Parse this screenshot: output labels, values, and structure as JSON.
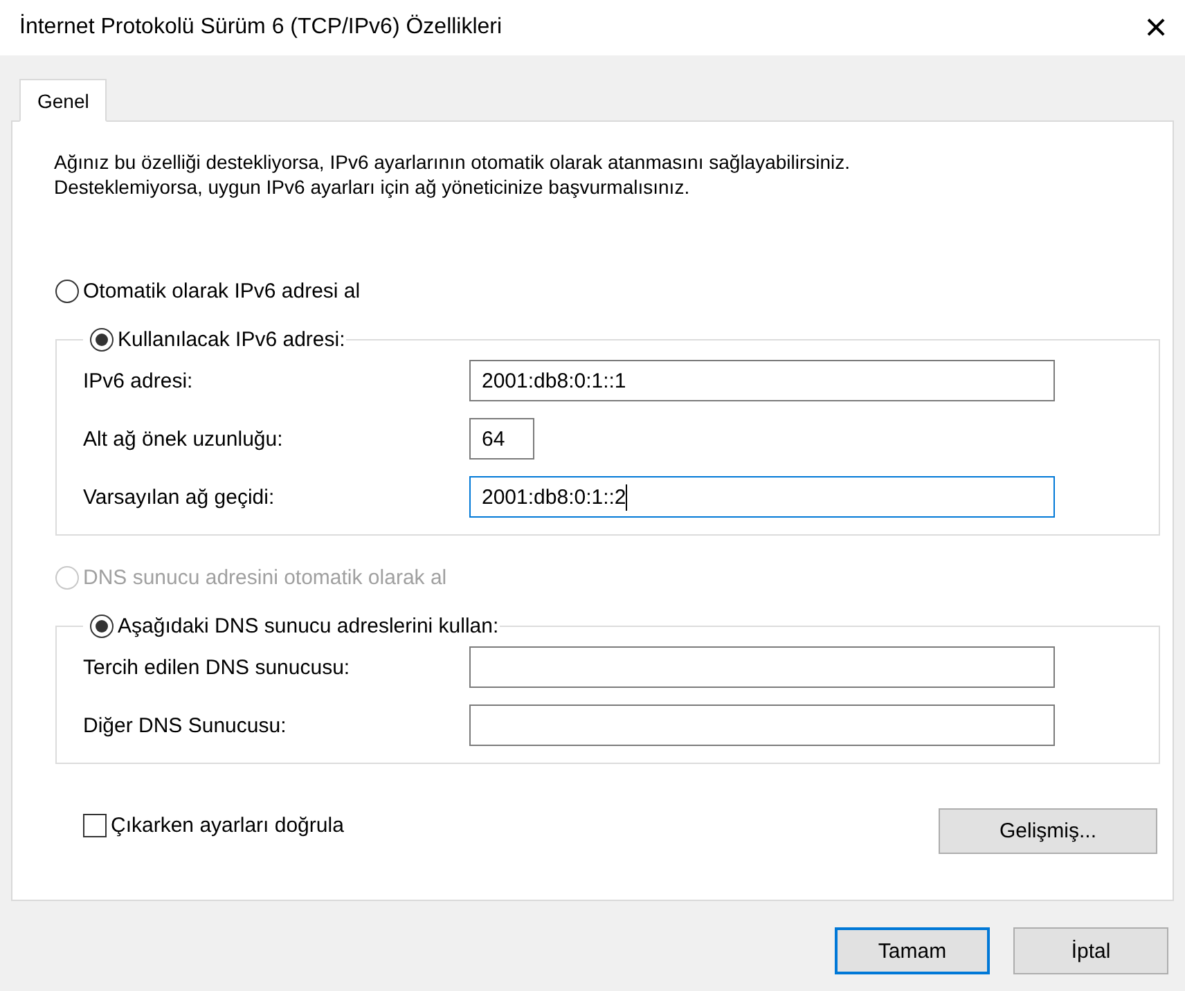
{
  "window": {
    "title": "İnternet Protokolü Sürüm 6 (TCP/IPv6) Özellikleri",
    "close": "×"
  },
  "tabs": [
    {
      "label": "Genel",
      "selected": true
    }
  ],
  "description": [
    "Ağınız bu özelliği destekliyorsa, IPv6 ayarlarının otomatik olarak atanmasını sağlayabilirsiniz.",
    "Desteklemiyorsa, uygun IPv6 ayarları için ağ yöneticinize başvurmalısınız."
  ],
  "address_section": {
    "auto_option": {
      "label": "Otomatik olarak IPv6 adresi al",
      "selected": false,
      "disabled": false
    },
    "manual_option": {
      "label": "Kullanılacak IPv6 adresi:",
      "selected": true,
      "disabled": false
    },
    "fields": [
      {
        "label": "IPv6 adresi:",
        "value": "2001:db8:0:1::1",
        "kind": "wide",
        "focused": false
      },
      {
        "label": "Alt ağ önek uzunluğu:",
        "value": "64",
        "kind": "short",
        "focused": false
      },
      {
        "label": "Varsayılan ağ geçidi:",
        "value": "2001:db8:0:1::2",
        "kind": "wide",
        "focused": true
      }
    ]
  },
  "dns_section": {
    "auto_option": {
      "label": "DNS sunucu adresini otomatik olarak al",
      "selected": false,
      "disabled": true
    },
    "manual_option": {
      "label": "Aşağıdaki DNS sunucu adreslerini kullan:",
      "selected": true,
      "disabled": false
    },
    "fields": [
      {
        "label": "Tercih edilen DNS sunucusu:",
        "kind": "wide",
        "focused": false
      },
      {
        "label": "Diğer DNS Sunucusu:",
        "kind": "wide",
        "focused": false
      }
    ]
  },
  "validate_checkbox": {
    "label": "Çıkarken ayarları doğrula",
    "checked": false
  },
  "advanced_button": "Gelişmiş...",
  "buttons": [
    {
      "label": "Tamam",
      "default": true
    },
    {
      "label": "İptal",
      "default": false
    }
  ]
}
